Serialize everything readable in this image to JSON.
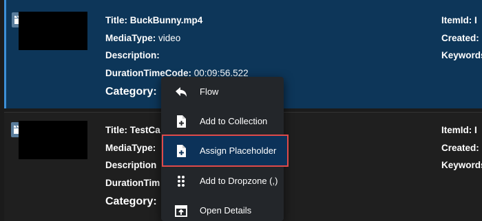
{
  "items": [
    {
      "media_icon": "clapperboard-icon",
      "title_label": "Title:",
      "title": "BuckBunny.mp4",
      "mediatype_label": "MediaType:",
      "mediatype": "video",
      "description_label": "Description:",
      "description": "",
      "duration_label": "DurationTimeCode:",
      "duration": "00:09:56.522",
      "category_label": "Category:",
      "itemid_label": "ItemId: I",
      "created_label": "Created:",
      "keywords_label": "Keywords"
    },
    {
      "media_icon": "clapperboard-icon",
      "title_label": "Title:",
      "title": "TestCa",
      "mediatype_label": "MediaType:",
      "mediatype": "",
      "description_label": "Description",
      "duration_label": "DurationTim",
      "category_label": "Category:",
      "itemid_label": "ItemId: I",
      "created_label": "Created:",
      "keywords_label": "Keywords"
    }
  ],
  "context_menu": {
    "items": [
      {
        "label": "Flow",
        "icon": "reply-arrow-icon"
      },
      {
        "label": "Add to Collection",
        "icon": "file-plus-icon"
      },
      {
        "label": "Assign Placeholder",
        "icon": "file-plus-icon",
        "highlighted": true
      },
      {
        "label": "Add to Dropzone (,)",
        "icon": "drag-dots-icon"
      },
      {
        "label": "Open Details",
        "icon": "open-window-icon"
      }
    ]
  },
  "colors": {
    "selected_bg": "#0d3659",
    "menu_bg": "#23262a",
    "highlight_outline": "#e04a4a",
    "accent": "#3d8fd6"
  }
}
